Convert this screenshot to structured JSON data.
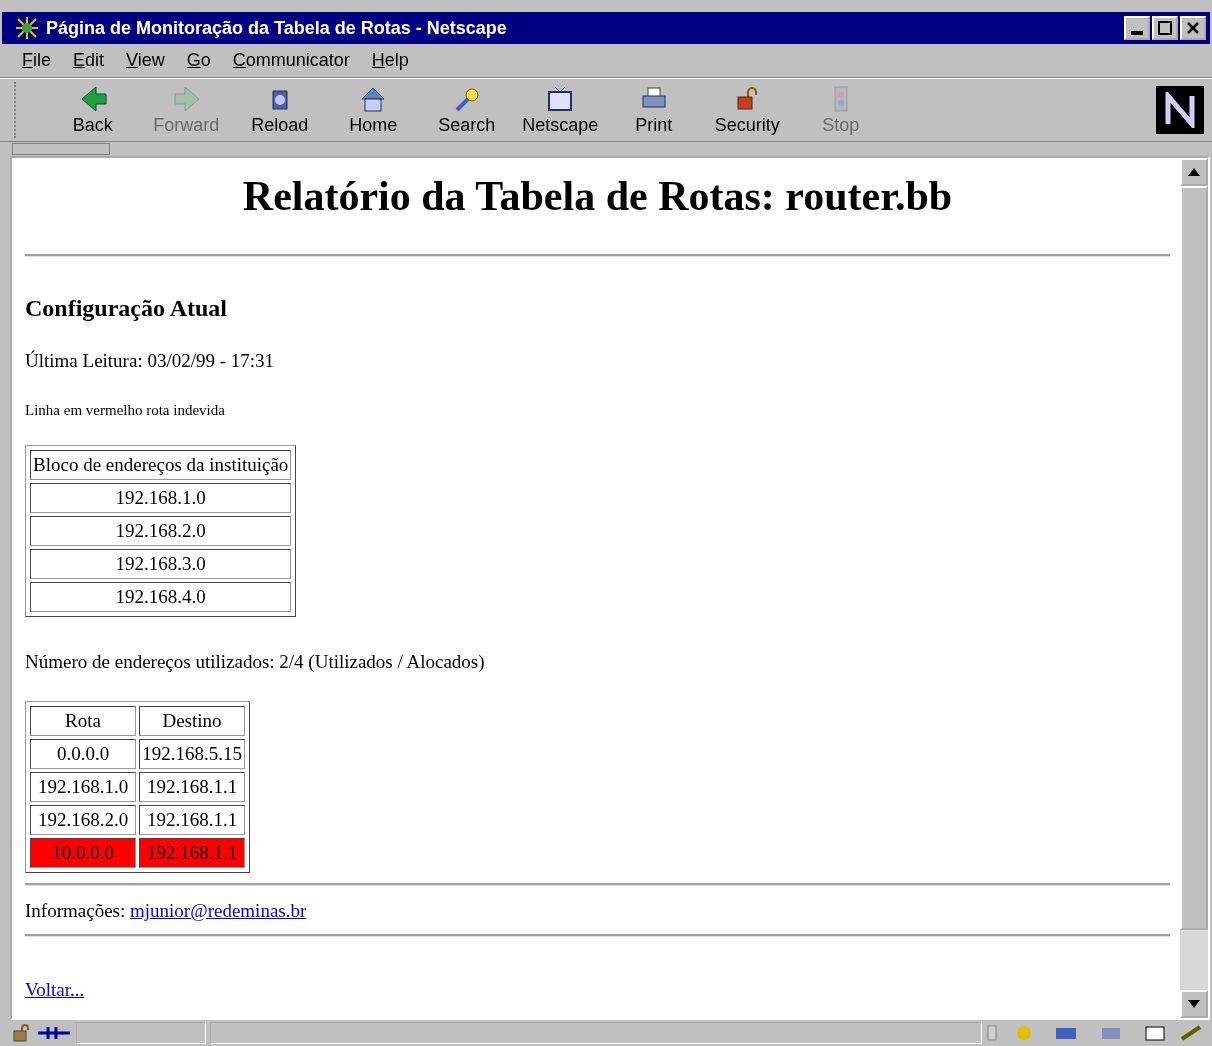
{
  "window": {
    "title": "Página de Monitoração da Tabela de Rotas - Netscape"
  },
  "menu": [
    "File",
    "Edit",
    "View",
    "Go",
    "Communicator",
    "Help"
  ],
  "toolbar": [
    {
      "label": "Back",
      "disabled": false
    },
    {
      "label": "Forward",
      "disabled": true
    },
    {
      "label": "Reload",
      "disabled": false
    },
    {
      "label": "Home",
      "disabled": false
    },
    {
      "label": "Search",
      "disabled": false
    },
    {
      "label": "Netscape",
      "disabled": false
    },
    {
      "label": "Print",
      "disabled": false
    },
    {
      "label": "Security",
      "disabled": false
    },
    {
      "label": "Stop",
      "disabled": true
    }
  ],
  "page": {
    "heading": "Relatório da Tabela de Rotas: router.bb",
    "section": "Configuração Atual",
    "last_read": "Última Leitura: 03/02/99 - 17:31",
    "legend": "Linha em vermelho rota indevida",
    "block_table": {
      "header": "Bloco de endereços da instituição",
      "rows": [
        "192.168.1.0",
        "192.168.2.0",
        "192.168.3.0",
        "192.168.4.0"
      ]
    },
    "usage": "Número de endereços utilizados: 2/4 (Utilizados / Alocados)",
    "route_table": {
      "columns": [
        "Rota",
        "Destino"
      ],
      "rows": [
        {
          "cells": [
            "0.0.0.0",
            "192.168.5.15"
          ],
          "flagged": false
        },
        {
          "cells": [
            "192.168.1.0",
            "192.168.1.1"
          ],
          "flagged": false
        },
        {
          "cells": [
            "192.168.2.0",
            "192.168.1.1"
          ],
          "flagged": false
        },
        {
          "cells": [
            "10.0.0.0",
            "192.168.1.1"
          ],
          "flagged": true
        }
      ]
    },
    "info_label": "Informações:",
    "info_link": "mjunior@redeminas.br",
    "back_link": "Voltar..."
  }
}
